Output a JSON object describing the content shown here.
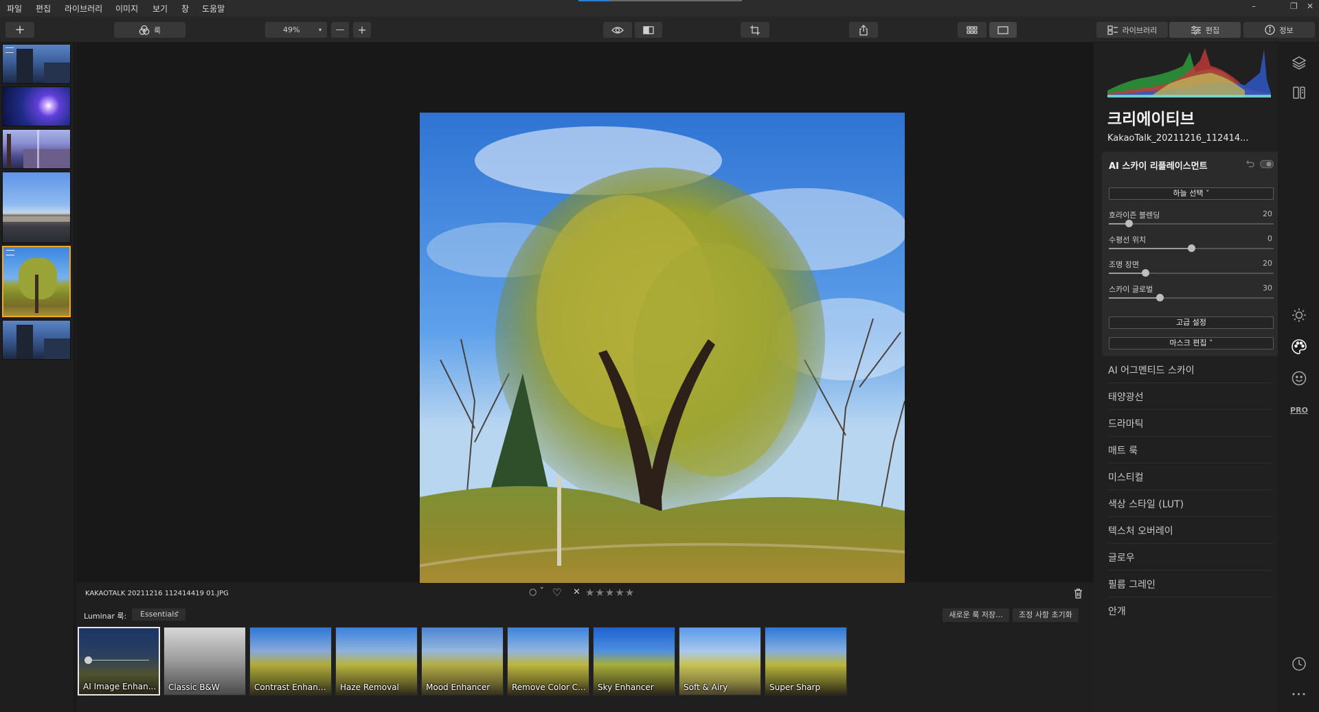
{
  "menu": [
    "파일",
    "편집",
    "라이브러리",
    "이미지",
    "보기",
    "창",
    "도움말"
  ],
  "window_controls": {
    "minimize": "–",
    "restore": "❐",
    "close": "✕"
  },
  "toolbar": {
    "add_label": "+",
    "looks_label": "룩",
    "zoom_value": "49%",
    "zoom_out": "—",
    "zoom_in": "+",
    "tab_library": "라이브러리",
    "tab_edit": "편집",
    "tab_info": "정보"
  },
  "image": {
    "filename": "KAKAOTALK 20211216 112414419 01.JPG"
  },
  "rating": {
    "stars": 0,
    "star_glyph": "★",
    "reject_glyph": "✕",
    "circle_glyph": "○ ˇ",
    "heart_glyph": "♡"
  },
  "looks": {
    "label": "Luminar 룩:",
    "category": "Essentials",
    "save_label": "새로운 룩 저장...",
    "reset_label": "조정 사항 초기화",
    "items": [
      {
        "label": "AI Image Enhan..."
      },
      {
        "label": "Classic B&W"
      },
      {
        "label": "Contrast Enhancer"
      },
      {
        "label": "Haze Removal"
      },
      {
        "label": "Mood Enhancer"
      },
      {
        "label": "Remove Color C..."
      },
      {
        "label": "Sky Enhancer"
      },
      {
        "label": "Soft & Airy"
      },
      {
        "label": "Super Sharp"
      }
    ]
  },
  "panel": {
    "section_title": "크리에이티브",
    "file_name": "KakaoTalk_20211216_112414...",
    "ai_sky": {
      "title": "AI 스카이 리플레이스먼트",
      "sky_select": "하늘 선택 ˅",
      "sliders": [
        {
          "label": "호라이즌 블렌딩",
          "value": "20",
          "level": 0.12
        },
        {
          "label": "수평선 위치",
          "value": "0",
          "level": 0.5
        },
        {
          "label": "조명 장면",
          "value": "20",
          "level": 0.22
        },
        {
          "label": "스카이 글로벌",
          "value": "30",
          "level": 0.31
        }
      ],
      "advanced": "고급 설정",
      "mask_edit": "마스크 편집 ˅"
    },
    "tools": [
      "AI 어그멘티드 스카이",
      "태양광선",
      "드라마틱",
      "매트 룩",
      "미스티컬",
      "색상 스타일 (LUT)",
      "텍스처 오버레이",
      "글로우",
      "필름 그레인",
      "안개"
    ]
  },
  "side_icons": {
    "pro_label": "PRO",
    "more_label": "•••"
  },
  "colors": {
    "accent": "#f5a623",
    "panel": "#202020",
    "canvas": "#181818"
  }
}
